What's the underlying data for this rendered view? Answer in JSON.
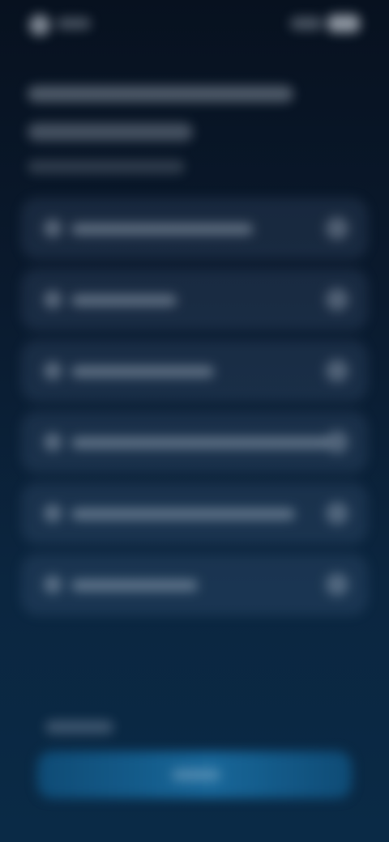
{
  "status": {
    "left_icon": "avatar-dot",
    "right_icons": [
      "signal-icon",
      "battery-icon"
    ]
  },
  "list": {
    "items": [
      {
        "icon": "circle-icon",
        "chevron": "chevron-right-icon"
      },
      {
        "icon": "circle-icon",
        "chevron": "chevron-right-icon"
      },
      {
        "icon": "circle-icon",
        "chevron": "chevron-right-icon"
      },
      {
        "icon": "circle-icon",
        "chevron": "chevron-right-icon"
      },
      {
        "icon": "circle-icon",
        "chevron": "chevron-right-icon"
      },
      {
        "icon": "circle-icon",
        "chevron": "chevron-right-icon"
      }
    ]
  },
  "colors": {
    "background_top": "#07111f",
    "background_bottom": "#0a2a46",
    "accent_button": "#1a6ea3"
  }
}
